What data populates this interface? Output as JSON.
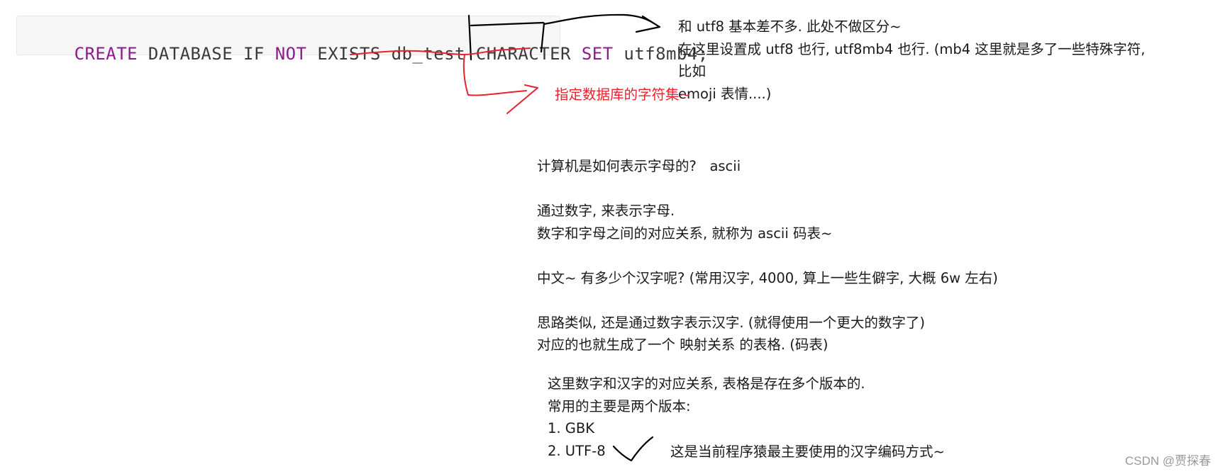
{
  "code": {
    "tokens": [
      {
        "text": "CREATE",
        "type": "keyword"
      },
      {
        "text": " DATABASE IF ",
        "type": "plain"
      },
      {
        "text": "NOT",
        "type": "keyword"
      },
      {
        "text": " EXISTS db_test CHARACTER ",
        "type": "plain"
      },
      {
        "text": "SET",
        "type": "keyword"
      },
      {
        "text": " utf8mb4;",
        "type": "plain"
      }
    ],
    "keyword_color": "#8e1b8e"
  },
  "annotations": {
    "right_note": "和 utf8 基本差不多. 此处不做区分~ 在这里设置成 utf8 也行, utf8mb4 也行. (mb4 这里就是多了一些特殊字符, 比如 emoji 表情....)",
    "right_note_lines": [
      "和 utf8 基本差不多. 此处不做区分~",
      "在这里设置成 utf8 也行, utf8mb4 也行. (mb4 这里就是多了一些特殊字符, 比如",
      "emoji 表情....)"
    ],
    "red_note": "指定数据库的字符集~",
    "red_color": "#e8222e",
    "ink_color": "#000000"
  },
  "body": {
    "lines": [
      "计算机是如何表示字母的?   ascii",
      "",
      "通过数字, 来表示字母.",
      "数字和字母之间的对应关系, 就称为 ascii 码表~",
      "",
      "中文~ 有多少个汉字呢? (常用汉字, 4000, 算上一些生僻字, 大概 6w 左右)",
      "",
      "思路类似, 还是通过数字表示汉字. (就得使用一个更大的数字了)",
      "对应的也就生成了一个 映射关系 的表格. (码表)"
    ],
    "indented": [
      "这里数字和汉字的对应关系, 表格是存在多个版本的.",
      "常用的主要是两个版本:",
      "1. GBK",
      "2. UTF-8"
    ],
    "utf8_note": "这是当前程序猿最主要使用的汉字编码方式~"
  },
  "watermark": "CSDN @贾探春"
}
